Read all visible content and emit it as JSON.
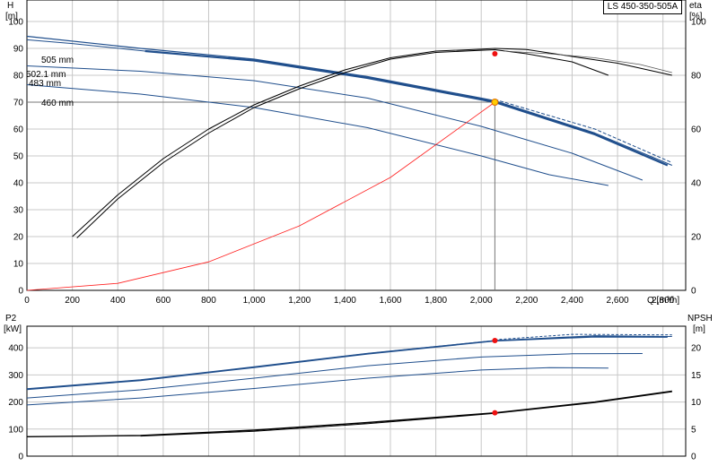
{
  "header": {
    "model": "LS 450-350-505A"
  },
  "top_chart": {
    "left_axis": {
      "title_line1": "H",
      "title_line2": "[m]"
    },
    "right_axis": {
      "title_line1": "eta",
      "title_line2": "[%]"
    },
    "x_axis": {
      "title": "Q [m³/h]"
    },
    "labels": {
      "d505": "505 mm",
      "d5021": "502.1 mm",
      "d483": "483 mm",
      "d460": "460 mm"
    }
  },
  "bottom_chart": {
    "left_axis": {
      "title_line1": "P2",
      "title_line2": "[kW]"
    },
    "right_axis": {
      "title_line1": "NPSH",
      "title_line2": "[m]"
    }
  },
  "chart_data": [
    {
      "type": "line",
      "title": "",
      "xlabel": "Q [m³/h]",
      "ylabel": "H [m]",
      "y2label": "eta [%]",
      "xlim": [
        0,
        2900
      ],
      "ylim": [
        0,
        108
      ],
      "y2lim": [
        0,
        108
      ],
      "xticks": [
        0,
        200,
        400,
        600,
        800,
        1000,
        1200,
        1400,
        1600,
        1800,
        2000,
        2200,
        2400,
        2600,
        2800
      ],
      "xticklabels": [
        "0",
        "200",
        "400",
        "600",
        "800",
        "1,000",
        "1,200",
        "1,400",
        "1,600",
        "1,800",
        "2,000",
        "2,200",
        "2,400",
        "2,600",
        "2,800"
      ],
      "yticks": [
        0,
        10,
        20,
        30,
        40,
        50,
        60,
        70,
        80,
        90,
        100
      ],
      "y2ticks": [
        0,
        20,
        40,
        60,
        80,
        100
      ],
      "grid": true,
      "duty_point": {
        "x": 2060,
        "y": 70,
        "eta": 88
      },
      "series": [
        {
          "name": "505 mm",
          "axis": "H",
          "color": "#1f4e8c",
          "width": 1.2,
          "x": [
            0,
            500,
            1000,
            1500,
            2000,
            2060,
            2500,
            2840
          ],
          "y": [
            94.5,
            90,
            86,
            79.5,
            71.5,
            70.5,
            58.5,
            46.5
          ]
        },
        {
          "name": "505 mm",
          "axis": "H",
          "color": "#1f4e8c",
          "width": 1.0,
          "dash": "4,2",
          "x": [
            2060,
            2300,
            2500,
            2840
          ],
          "y": [
            71,
            65,
            60,
            47.5
          ]
        },
        {
          "name": "502.1 mm",
          "axis": "H",
          "color": "#1f4e8c",
          "width": 2.2,
          "x": [
            520,
            1000,
            1500,
            2000,
            2060,
            2500,
            2820
          ],
          "y": [
            89,
            85.5,
            79,
            71,
            70,
            58,
            46.5
          ]
        },
        {
          "name": "502.1 mm",
          "axis": "H",
          "color": "#1f4e8c",
          "width": 1.0,
          "x": [
            0,
            200,
            520
          ],
          "y": [
            93.2,
            91.8,
            89
          ]
        },
        {
          "name": "483 mm",
          "axis": "H",
          "color": "#1f4e8c",
          "width": 1.0,
          "x": [
            0,
            500,
            1000,
            1500,
            2000,
            2400,
            2710
          ],
          "y": [
            83.5,
            81.5,
            78,
            71.5,
            61,
            51,
            41
          ]
        },
        {
          "name": "460 mm",
          "axis": "H",
          "color": "#1f4e8c",
          "width": 1.0,
          "x": [
            0,
            500,
            1000,
            1500,
            2000,
            2300,
            2560
          ],
          "y": [
            76.5,
            73,
            68,
            60.5,
            50,
            43,
            39
          ]
        },
        {
          "name": "",
          "axis": "H",
          "color": "#ff2020",
          "width": 0.8,
          "x": [
            0,
            400,
            800,
            1200,
            1600,
            2060
          ],
          "y": [
            0,
            2.6,
            10.6,
            24,
            42,
            70
          ]
        },
        {
          "name": "",
          "axis": "eta",
          "color": "#000000",
          "width": 1.0,
          "x": [
            200,
            400,
            600,
            800,
            1000,
            1200,
            1400,
            1600,
            1800,
            2000,
            2060,
            2200,
            2400,
            2600,
            2840
          ],
          "y": [
            20,
            35.5,
            49,
            60,
            69,
            76,
            82,
            86.5,
            89,
            89.7,
            90,
            89.6,
            87,
            84.5,
            80
          ]
        },
        {
          "name": "",
          "axis": "eta",
          "color": "#000000",
          "width": 1.0,
          "x": [
            220,
            400,
            600,
            800,
            1000,
            1200,
            1400,
            1600,
            1800,
            2000,
            2060,
            2200,
            2400,
            2560
          ],
          "y": [
            19.5,
            34,
            47.5,
            58.5,
            68,
            75,
            81,
            86,
            88.5,
            89.3,
            89.5,
            88,
            85,
            80
          ]
        },
        {
          "name": "",
          "axis": "eta",
          "color": "#555555",
          "width": 0.8,
          "x": [
            2100,
            2300,
            2500,
            2700,
            2840
          ],
          "y": [
            89,
            88,
            86.5,
            84,
            81
          ]
        }
      ]
    },
    {
      "type": "line",
      "title": "",
      "xlabel": "Q [m³/h]",
      "ylabel": "P2 [kW]",
      "y2label": "NPSH [m]",
      "xlim": [
        0,
        2900
      ],
      "ylim": [
        0,
        480
      ],
      "y2lim": [
        0,
        24
      ],
      "yticks": [
        0,
        100,
        200,
        300,
        400
      ],
      "y2ticks": [
        0,
        5,
        10,
        15,
        20
      ],
      "grid": true,
      "duty_point": {
        "x": 2060,
        "p2": 427,
        "npsh": 8
      },
      "series": [
        {
          "name": "505 mm",
          "axis": "P2",
          "color": "#1f4e8c",
          "width": 1.0,
          "x": [
            0,
            500,
            1000,
            1500,
            2060,
            2500,
            2840
          ],
          "y": [
            249,
            282,
            330,
            380,
            427,
            445,
            442
          ]
        },
        {
          "name": "505 mm",
          "axis": "P2",
          "color": "#1f4e8c",
          "width": 1.0,
          "dash": "3,2",
          "x": [
            2060,
            2400,
            2840
          ],
          "y": [
            430,
            450,
            448
          ]
        },
        {
          "name": "502.1 mm",
          "axis": "P2",
          "color": "#1f4e8c",
          "width": 1.6,
          "x": [
            0,
            500,
            1000,
            1500,
            2060,
            2500,
            2820
          ],
          "y": [
            247,
            280,
            328,
            378,
            426,
            441,
            440
          ]
        },
        {
          "name": "483 mm",
          "axis": "P2",
          "color": "#1f4e8c",
          "width": 1.0,
          "x": [
            0,
            500,
            1000,
            1500,
            2000,
            2400,
            2710
          ],
          "y": [
            215,
            245,
            288,
            334,
            366,
            378,
            379
          ]
        },
        {
          "name": "460 mm",
          "axis": "P2",
          "color": "#1f4e8c",
          "width": 1.0,
          "x": [
            0,
            500,
            1000,
            1500,
            2000,
            2300,
            2560
          ],
          "y": [
            189,
            215,
            250,
            288,
            318,
            327,
            325
          ]
        },
        {
          "name": "",
          "axis": "NPSH",
          "color": "#000000",
          "width": 1.4,
          "x": [
            0,
            500,
            1000,
            1500,
            2060,
            2500,
            2840
          ],
          "y": [
            3.6,
            3.8,
            4.8,
            6.2,
            8.0,
            10.0,
            12.0
          ]
        },
        {
          "name": "",
          "axis": "NPSH",
          "color": "#000000",
          "width": 1.0,
          "x": [
            500,
            1000,
            1500,
            2060,
            2500,
            2840
          ],
          "y": [
            3.7,
            4.6,
            6.0,
            7.9,
            9.9,
            11.9
          ]
        }
      ]
    }
  ]
}
